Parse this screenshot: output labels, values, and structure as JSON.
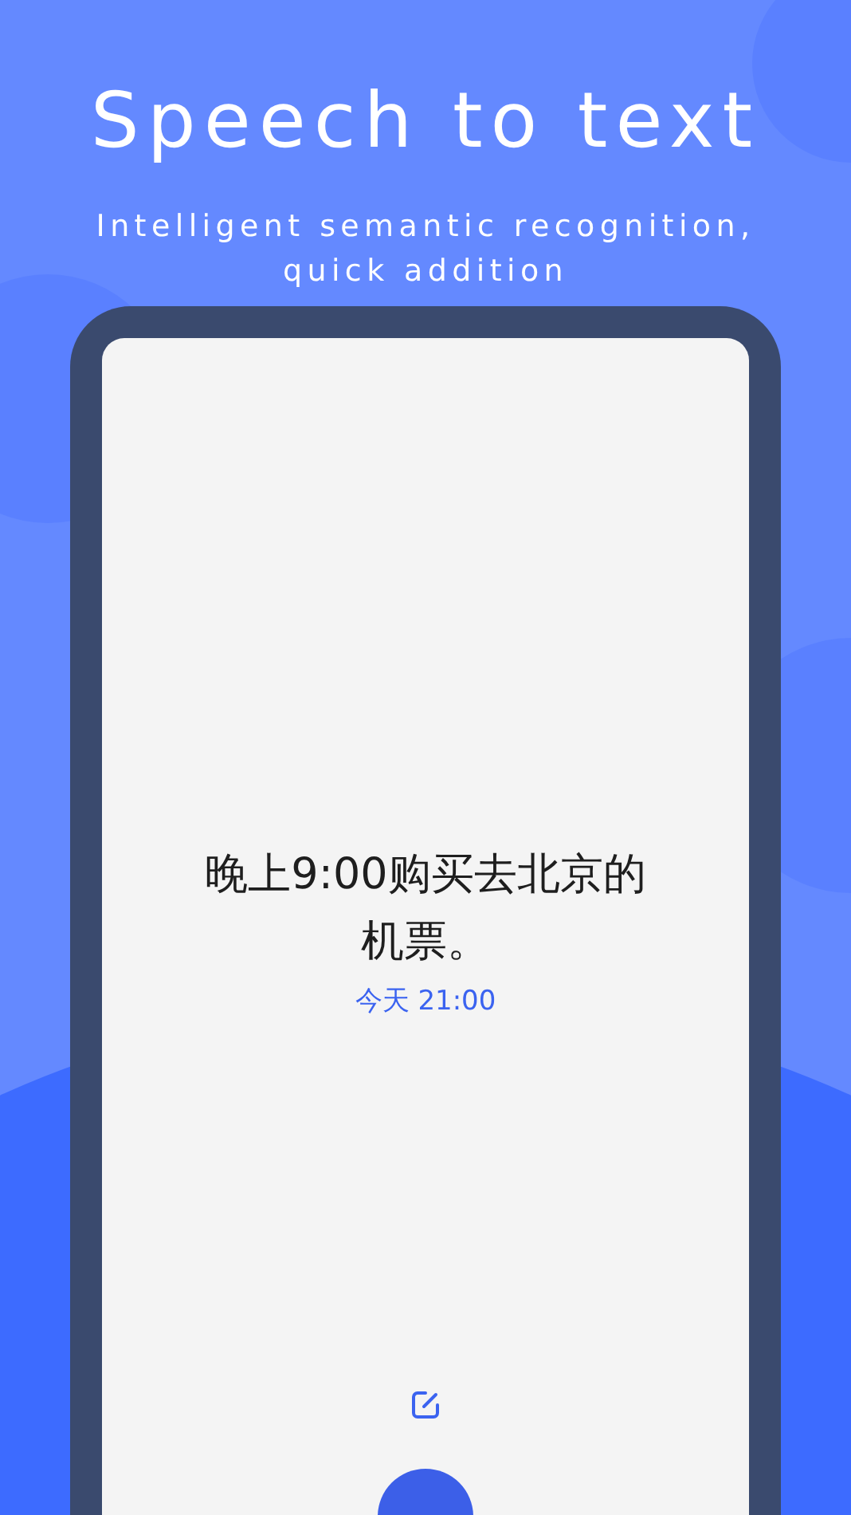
{
  "headline": "Speech to text",
  "subtitle": "Intelligent semantic recognition, quick addition",
  "note": {
    "text": "晚上9:00购买去北京的机票。",
    "time": "今天 21:00"
  }
}
